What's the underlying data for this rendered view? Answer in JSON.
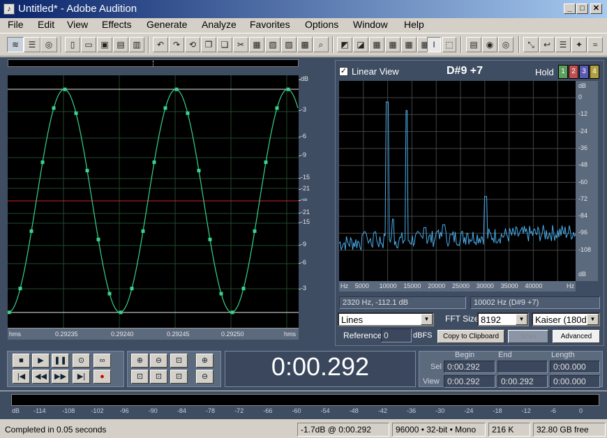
{
  "window": {
    "title": "Untitled* - Adobe Audition",
    "controls": [
      "_",
      "□",
      "✕"
    ]
  },
  "menu": [
    "File",
    "Edit",
    "View",
    "Effects",
    "Generate",
    "Analyze",
    "Favorites",
    "Options",
    "Window",
    "Help"
  ],
  "waveform": {
    "db_labels": [
      "dB",
      "-3",
      "-6",
      "-9",
      "-15",
      "-21",
      "-∞",
      "-21",
      "-15",
      "-9",
      "-6",
      "-3"
    ],
    "time_ruler": {
      "unit_left": "hms",
      "unit_right": "hms",
      "ticks": [
        "0.29235",
        "0.29240",
        "0.29245",
        "0.29250"
      ]
    },
    "colors": {
      "wave": "#3ad38c",
      "center": "#d02020",
      "grid": "#1e4a2a"
    }
  },
  "frequency_analysis": {
    "linear_view_label": "Linear View",
    "linear_view_checked": true,
    "note": "D#9 +7",
    "hold_label": "Hold",
    "hold_buttons": [
      "1",
      "2",
      "3",
      "4"
    ],
    "hold_colors": [
      "#5aa05a",
      "#c05050",
      "#5a5ab0",
      "#b0a040"
    ],
    "y_labels": [
      "dB",
      "0",
      "-12",
      "-24",
      "-36",
      "-48",
      "-60",
      "-72",
      "-84",
      "-96",
      "-108",
      "dB"
    ],
    "x_labels": [
      "Hz",
      "5000",
      "10000",
      "15000",
      "20000",
      "25000",
      "30000",
      "35000",
      "40000",
      "Hz"
    ],
    "cursor_readout": "2320 Hz, -112.1 dB",
    "peak_readout": "10002 Hz (D#9 +7)",
    "display_mode": "Lines",
    "fft_size_label": "FFT Size",
    "fft_size": "8192",
    "window_function": "Kaiser (180d",
    "reference_label": "Reference",
    "reference_value": "0",
    "reference_unit": "dBFS",
    "copy_button": "Copy to Clipboard",
    "scan_button": "Scan",
    "advanced_button": "Advanced",
    "spectrum_color": "#4ab0f0"
  },
  "transport": {
    "time": "0:00.292"
  },
  "selection": {
    "headers": [
      "Begin",
      "End",
      "Length"
    ],
    "sel_label": "Sel",
    "view_label": "View",
    "sel": [
      "0:00.292",
      "",
      "0:00.000"
    ],
    "view": [
      "0:00.292",
      "0:00.292",
      "0:00.000"
    ]
  },
  "level_meter": {
    "ticks": [
      "dB",
      "-114",
      "-108",
      "-102",
      "-96",
      "-90",
      "-84",
      "-78",
      "-72",
      "-66",
      "-60",
      "-54",
      "-48",
      "-42",
      "-36",
      "-30",
      "-24",
      "-18",
      "-12",
      "-6",
      "0"
    ]
  },
  "status": {
    "message": "Completed in 0.05 seconds",
    "level": "-1.7dB @ 0:00.292",
    "format": "96000 • 32-bit • Mono",
    "size": "216 K",
    "free": "32.80 GB free"
  }
}
